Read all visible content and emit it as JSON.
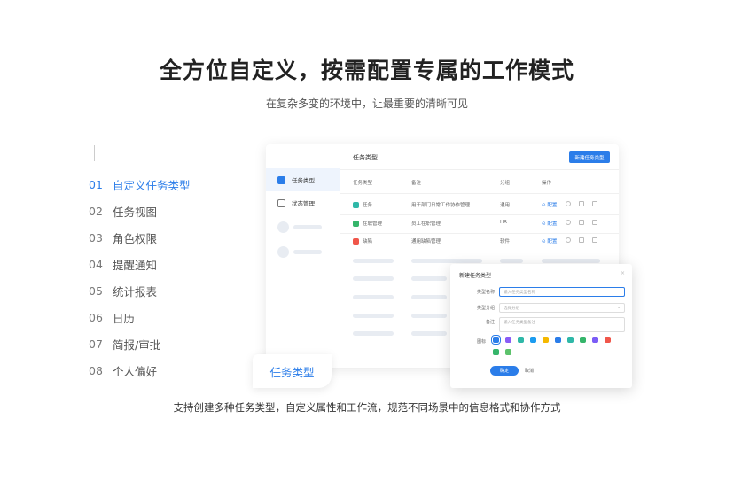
{
  "title": "全方位自定义，按需配置专属的工作模式",
  "subtitle": "在复杂多变的环境中，让最重要的清晰可见",
  "features": [
    {
      "num": "01",
      "label": "自定义任务类型",
      "active": true
    },
    {
      "num": "02",
      "label": "任务视图"
    },
    {
      "num": "03",
      "label": "角色权限"
    },
    {
      "num": "04",
      "label": "提醒通知"
    },
    {
      "num": "05",
      "label": "统计报表"
    },
    {
      "num": "06",
      "label": "日历"
    },
    {
      "num": "07",
      "label": "简报/审批"
    },
    {
      "num": "08",
      "label": "个人偏好"
    }
  ],
  "app": {
    "sidebar": [
      {
        "label": "任务类型",
        "icon": "check-icon"
      },
      {
        "label": "状态管理",
        "icon": "grid-icon"
      }
    ],
    "header": "任务类型",
    "new_button": "新建任务类型",
    "columns": [
      "任务类型",
      "备注",
      "分组",
      "操作"
    ],
    "rows": [
      {
        "name": "任务",
        "note": "用于部门日常工作协作管理",
        "group": "通用",
        "action": "配置",
        "color": "#2fb8a8"
      },
      {
        "name": "在职管理",
        "note": "员工在职管理",
        "group": "HR",
        "action": "配置",
        "color": "#35b56a"
      },
      {
        "name": "缺陷",
        "note": "通用缺陷管理",
        "group": "软件",
        "action": "配置",
        "color": "#f0564a"
      }
    ]
  },
  "modal": {
    "title": "新建任务类型",
    "close": "×",
    "fields": [
      {
        "label": "类型名称",
        "placeholder": "输入任务类型名称"
      },
      {
        "label": "类型分组",
        "placeholder": "选择分组"
      },
      {
        "label": "备注",
        "placeholder": "输入任务类型备注"
      }
    ],
    "icon_label": "图标",
    "icon_colors": [
      "#2b7de9",
      "#8a5cf6",
      "#2fb8a8",
      "#1c9cf0",
      "#f5b800",
      "#2b7de9",
      "#2fb8a8",
      "#35b56a",
      "#7b5cf6",
      "#f0564a",
      "#35b56a",
      "#5cc26b"
    ],
    "ok": "确定",
    "cancel": "取消"
  },
  "badge": "任务类型",
  "caption": "支持创建多种任务类型，自定义属性和工作流，规范不同场景中的信息格式和协作方式"
}
